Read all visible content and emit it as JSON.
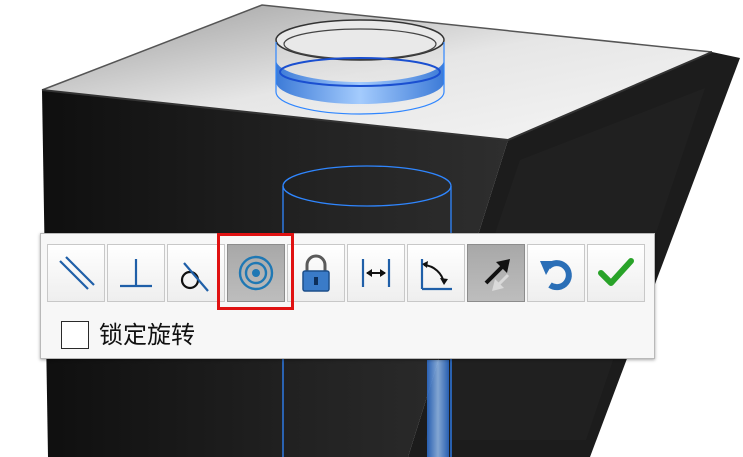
{
  "toolbar": {
    "buttons": [
      {
        "icon": "parallel-icon",
        "pressed": false
      },
      {
        "icon": "perpendicular-icon",
        "pressed": false
      },
      {
        "icon": "tangent-icon",
        "pressed": false
      },
      {
        "icon": "concentric-icon",
        "pressed": true,
        "highlighted": true
      },
      {
        "icon": "lock-icon",
        "pressed": false
      },
      {
        "icon": "distance-icon",
        "pressed": false
      },
      {
        "icon": "angle-icon",
        "pressed": false
      },
      {
        "icon": "flip-alignment-icon",
        "pressed": true
      },
      {
        "icon": "undo-icon",
        "pressed": false
      },
      {
        "icon": "confirm-check-icon",
        "pressed": false
      }
    ],
    "lock_rotation_label": "锁定旋转",
    "lock_rotation_checked": false
  },
  "colors": {
    "highlight": "#e01212",
    "edge_blue": "#2f86ff",
    "confirm_green": "#29a329",
    "icon_blue": "#1f78b4",
    "body_dark": "#1a1a1a"
  }
}
